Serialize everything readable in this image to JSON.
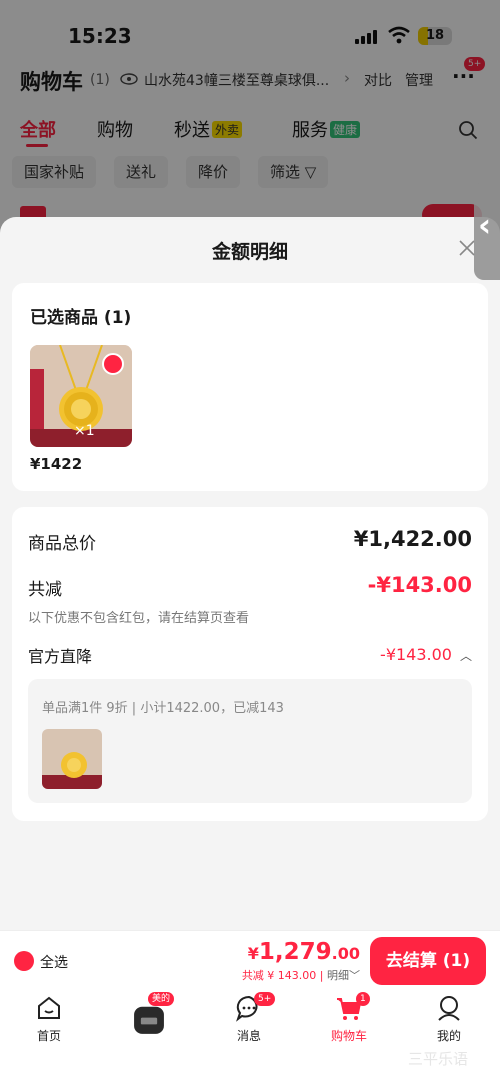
{
  "status_bar": {
    "time": "15:23",
    "battery": "18"
  },
  "header": {
    "title": "购物车",
    "count": "(1)",
    "address": "山水苑43幢三楼至尊桌球俱...",
    "compare": "对比",
    "manage": "管理",
    "more_badge": "5+"
  },
  "tabs": [
    {
      "label": "全部",
      "tag": ""
    },
    {
      "label": "购物",
      "tag": ""
    },
    {
      "label": "秒送",
      "tag": "外卖"
    },
    {
      "label": "服务",
      "tag": "健康"
    }
  ],
  "filters": [
    "国家补贴",
    "送礼",
    "降价",
    "筛选"
  ],
  "sheet": {
    "title": "金额明细",
    "selected_title": "已选商品 (1)",
    "product_qty": "×1",
    "product_price": "¥1422",
    "total_label": "商品总价",
    "total_value": "¥1,422.00",
    "discount_label": "共减",
    "discount_value": "-¥143.00",
    "note": "以下优惠不包含红包，请在结算页查看",
    "official_label": "官方直降",
    "official_value": "-¥143.00",
    "promo_detail": "单品满1件 9折 | 小计1422.00，已减143"
  },
  "checkout": {
    "select_all": "全选",
    "price_symbol": "¥",
    "price_int": "1,279",
    "price_dec": ".00",
    "discount_text": "共减 ¥ 143.00 |",
    "detail": "明细",
    "button": "去结算 (1)"
  },
  "nav": {
    "home": "首页",
    "meide_badge": "美的",
    "messages": "消息",
    "messages_badge": "5+",
    "cart": "购物车",
    "cart_badge": "1",
    "mine": "我的"
  },
  "watermark": "三平乐语",
  "colors": {
    "accent": "#ff2442",
    "gold": "#f2c230"
  }
}
